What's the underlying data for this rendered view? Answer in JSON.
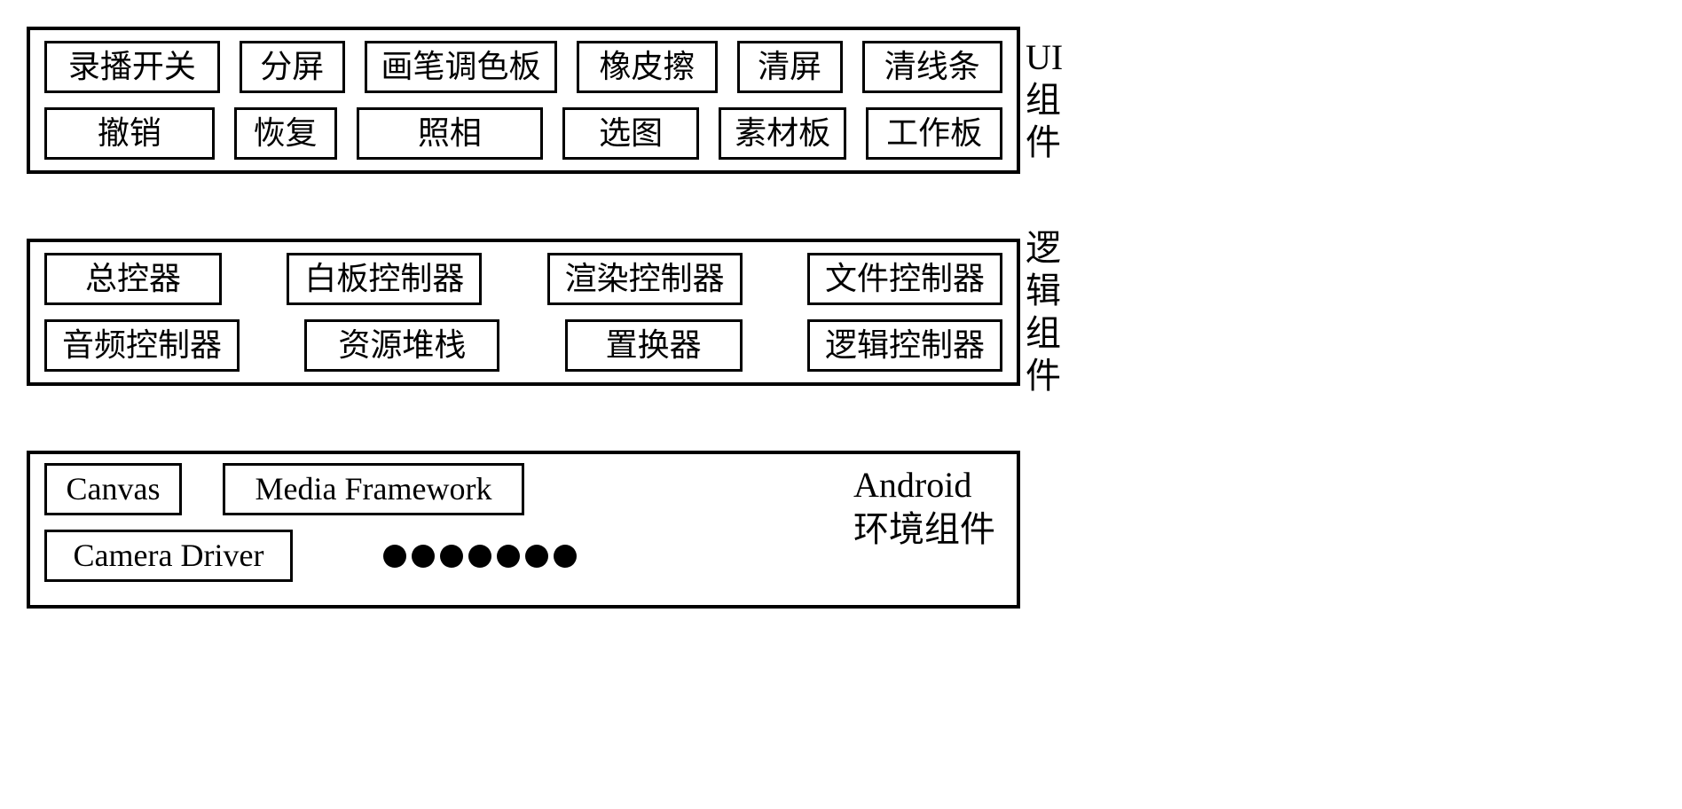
{
  "layers": {
    "ui": {
      "label": "UI组件",
      "row1": [
        "录播开关",
        "分屏",
        "画笔调色板",
        "橡皮擦",
        "清屏",
        "清线条"
      ],
      "row2": [
        "撤销",
        "恢复",
        "照相",
        "选图",
        "素材板",
        "工作板"
      ]
    },
    "logic": {
      "label": "逻辑组件",
      "row1": [
        "总控器",
        "白板控制器",
        "渲染控制器",
        "文件控制器"
      ],
      "row2": [
        "音频控制器",
        "资源堆栈",
        "置换器",
        "逻辑控制器"
      ]
    },
    "android": {
      "label_en": "Android",
      "label_cn": "环境组件",
      "row1": [
        "Canvas",
        "Media Framework"
      ],
      "row2": [
        "Camera Driver"
      ],
      "dots_count": 7
    }
  }
}
